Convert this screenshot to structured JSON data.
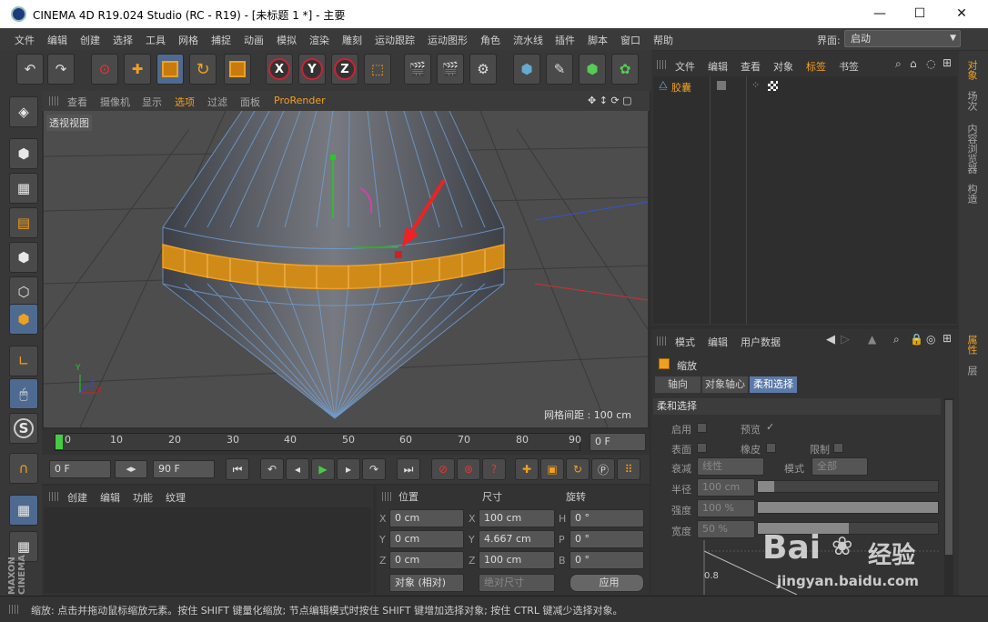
{
  "window": {
    "title": "CINEMA 4D R19.024 Studio (RC - R19) - [未标题 1 *] - 主要",
    "min": "—",
    "max": "☐",
    "close": "✕"
  },
  "menu": [
    "文件",
    "编辑",
    "创建",
    "选择",
    "工具",
    "网格",
    "捕捉",
    "动画",
    "模拟",
    "渲染",
    "雕刻",
    "运动跟踪",
    "运动图形",
    "角色",
    "流水线",
    "插件",
    "脚本",
    "窗口",
    "帮助"
  ],
  "layout": {
    "label": "界面:",
    "value": "启动"
  },
  "viewport": {
    "menu": [
      "查看",
      "摄像机",
      "显示",
      "选项",
      "过滤",
      "面板",
      "ProRender"
    ],
    "label": "透视视图",
    "grid_info": "网格间距 : 100 cm",
    "axis_y": "Y",
    "axis_x": "X",
    "axis_z": "Z"
  },
  "timeline": {
    "ticks": [
      "0",
      "10",
      "20",
      "30",
      "40",
      "50",
      "60",
      "70",
      "80",
      "90"
    ],
    "frame_field": "0 F"
  },
  "playback": {
    "start": "0 F",
    "end": "90 F"
  },
  "material": {
    "tabs": [
      "创建",
      "编辑",
      "功能",
      "纹理"
    ]
  },
  "coords": {
    "headers": [
      "位置",
      "尺寸",
      "旋转"
    ],
    "rows": [
      {
        "a": "X",
        "p": "0 cm",
        "b": "X",
        "s": "100 cm",
        "c": "H",
        "r": "0 °"
      },
      {
        "a": "Y",
        "p": "0 cm",
        "b": "Y",
        "s": "4.667 cm",
        "c": "P",
        "r": "0 °"
      },
      {
        "a": "Z",
        "p": "0 cm",
        "b": "Z",
        "s": "100 cm",
        "c": "B",
        "r": "0 °"
      }
    ],
    "mode": "对象 (相对)",
    "size_mode": "绝对尺寸",
    "apply": "应用"
  },
  "objects": {
    "menu": [
      "文件",
      "编辑",
      "查看",
      "对象",
      "标签",
      "书签"
    ],
    "item": "胶囊"
  },
  "attributes": {
    "menu": [
      "模式",
      "编辑",
      "用户数据"
    ],
    "title": "缩放",
    "tabs": [
      "轴向",
      "对象轴心",
      "柔和选择"
    ],
    "section": "柔和选择",
    "enable": "启用",
    "preview": "预览",
    "preview_mark": "✓",
    "surface": "表面",
    "rubber": "橡皮",
    "limit": "限制",
    "falloff": "衰减",
    "falloff_val": "线性",
    "mode": "模式",
    "mode_val": "全部",
    "radius": "半径",
    "radius_val": "100 cm",
    "strength": "强度",
    "strength_val": "100 %",
    "width": "宽度",
    "width_val": "50 %",
    "graph_val": "0.8"
  },
  "right_tabs": [
    "对象",
    "场次",
    "内容浏览器",
    "构造"
  ],
  "right_tabs2": [
    "属性",
    "层"
  ],
  "status": "缩放: 点击并拖动鼠标缩放元素。按住 SHIFT 键量化缩放; 节点编辑模式时按住 SHIFT 键增加选择对象; 按住 CTRL 键减少选择对象。",
  "watermark": {
    "brand": "Bai",
    "suffix": "经验",
    "url": "jingyan.baidu.com"
  },
  "colors": {
    "accent": "#e8a020",
    "selection": "#f0a020",
    "blue": "#4e6a90"
  }
}
